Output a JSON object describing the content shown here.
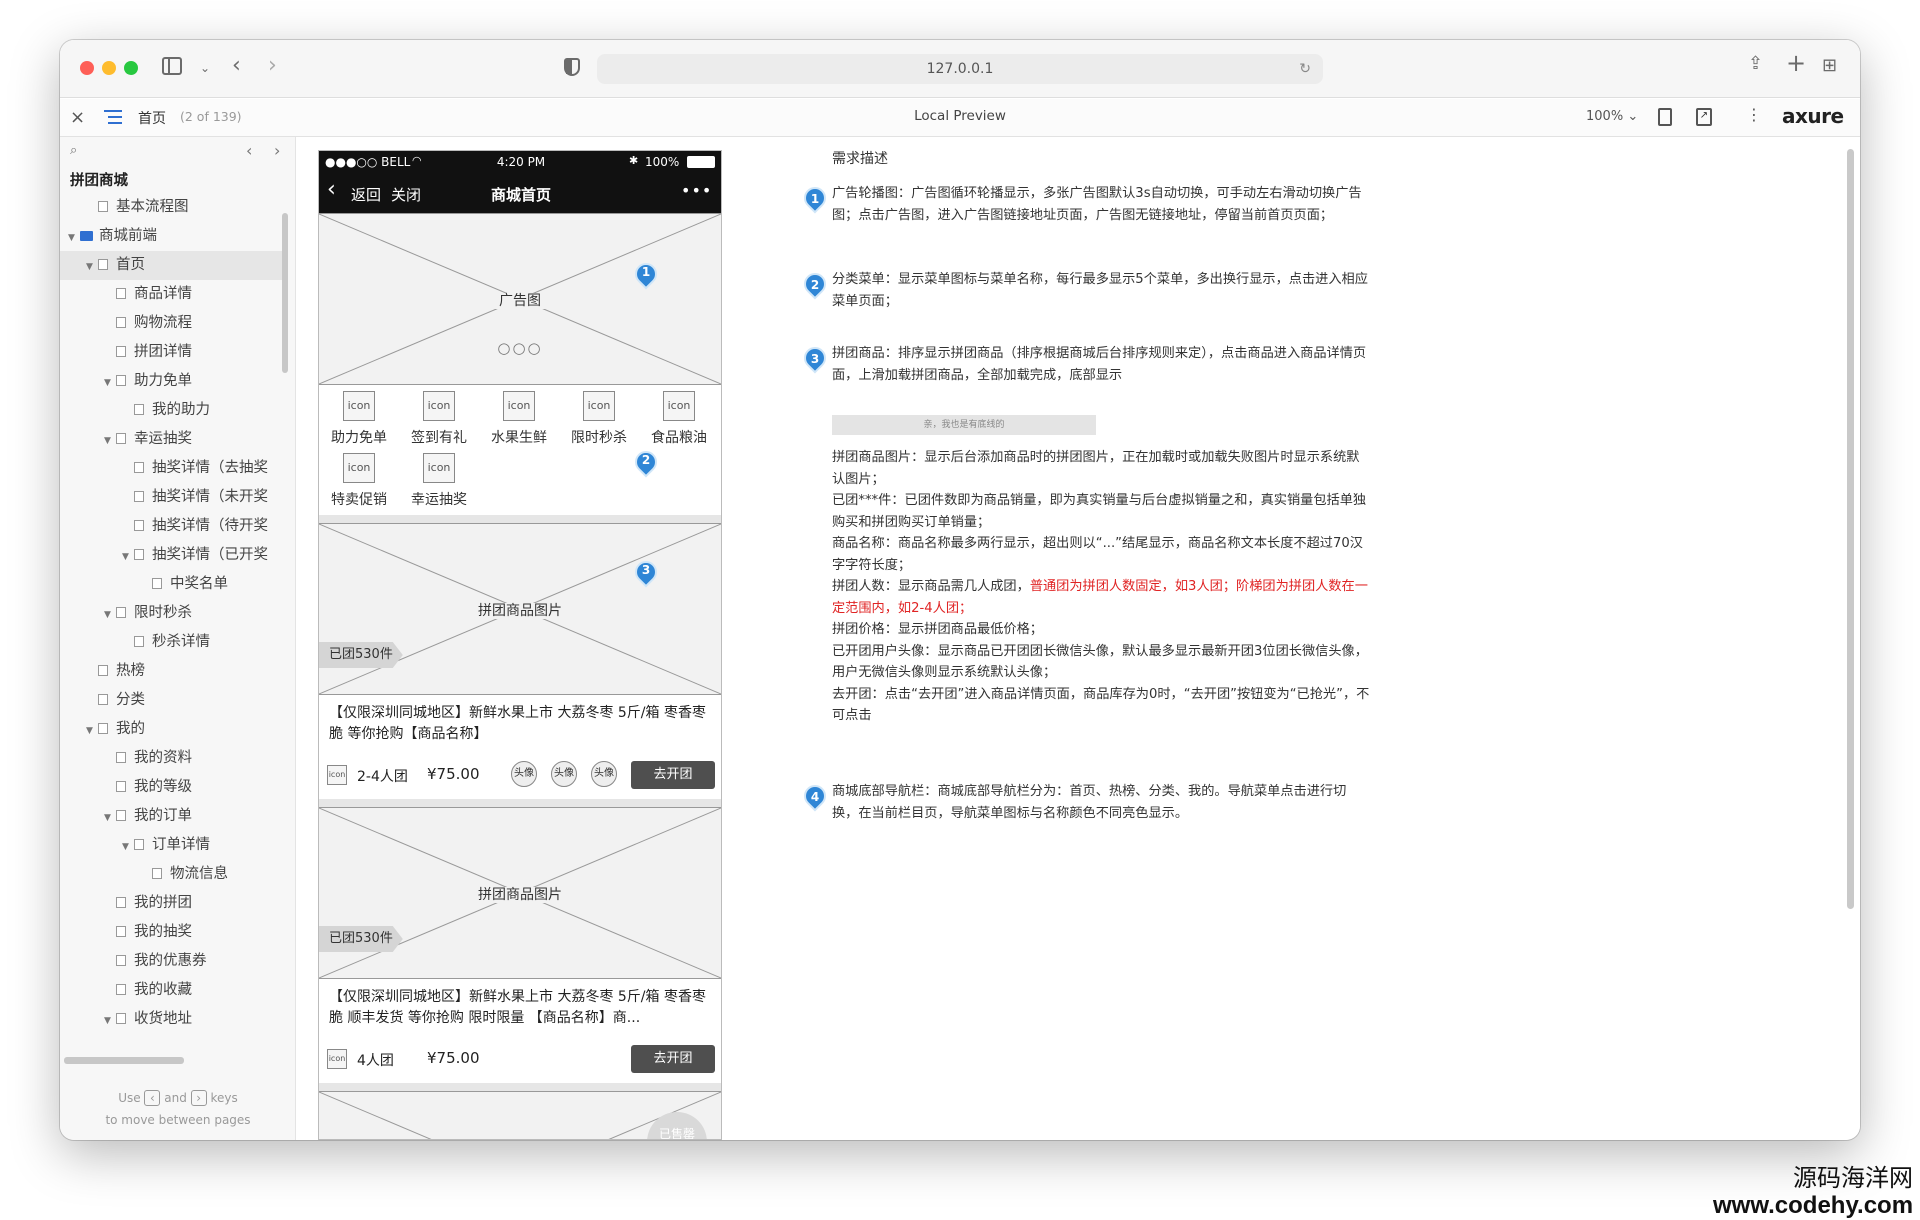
{
  "browser": {
    "url": "127.0.0.1",
    "traffic_colors": [
      "#fe5f57",
      "#febc2e",
      "#28c840"
    ]
  },
  "toolbar": {
    "close_label": "×",
    "page_name": "首页",
    "page_count": "(2 of 139)",
    "center_title": "Local Preview",
    "zoom": "100%",
    "brand": "axure"
  },
  "sidebar": {
    "nav_hint_1": "Use",
    "nav_hint_and": "and",
    "nav_hint_keys": "keys",
    "nav_hint_2": "to move between pages",
    "root": "拼团商城",
    "items": [
      {
        "label": "基本流程图",
        "level": 1,
        "type": "page",
        "arrow": ""
      },
      {
        "label": "商城前端",
        "level": 0,
        "type": "folder",
        "arrow": "▼"
      },
      {
        "label": "首页",
        "level": 1,
        "type": "page",
        "arrow": "▼",
        "selected": true
      },
      {
        "label": "商品详情",
        "level": 2,
        "type": "page",
        "arrow": ""
      },
      {
        "label": "购物流程",
        "level": 2,
        "type": "page",
        "arrow": ""
      },
      {
        "label": "拼团详情",
        "level": 2,
        "type": "page",
        "arrow": ""
      },
      {
        "label": "助力免单",
        "level": 2,
        "type": "page",
        "arrow": "▼"
      },
      {
        "label": "我的助力",
        "level": 3,
        "type": "page",
        "arrow": ""
      },
      {
        "label": "幸运抽奖",
        "level": 2,
        "type": "page",
        "arrow": "▼"
      },
      {
        "label": "抽奖详情（去抽奖",
        "level": 3,
        "type": "page",
        "arrow": ""
      },
      {
        "label": "抽奖详情（未开奖",
        "level": 3,
        "type": "page",
        "arrow": ""
      },
      {
        "label": "抽奖详情（待开奖",
        "level": 3,
        "type": "page",
        "arrow": ""
      },
      {
        "label": "抽奖详情（已开奖",
        "level": 3,
        "type": "page",
        "arrow": "▼"
      },
      {
        "label": "中奖名单",
        "level": 4,
        "type": "page",
        "arrow": ""
      },
      {
        "label": "限时秒杀",
        "level": 2,
        "type": "page",
        "arrow": "▼"
      },
      {
        "label": "秒杀详情",
        "level": 3,
        "type": "page",
        "arrow": ""
      },
      {
        "label": "热榜",
        "level": 1,
        "type": "page",
        "arrow": ""
      },
      {
        "label": "分类",
        "level": 1,
        "type": "page",
        "arrow": ""
      },
      {
        "label": "我的",
        "level": 1,
        "type": "page",
        "arrow": "▼"
      },
      {
        "label": "我的资料",
        "level": 2,
        "type": "page",
        "arrow": ""
      },
      {
        "label": "我的等级",
        "level": 2,
        "type": "page",
        "arrow": ""
      },
      {
        "label": "我的订单",
        "level": 2,
        "type": "page",
        "arrow": "▼"
      },
      {
        "label": "订单详情",
        "level": 3,
        "type": "page",
        "arrow": "▼"
      },
      {
        "label": "物流信息",
        "level": 4,
        "type": "page",
        "arrow": ""
      },
      {
        "label": "我的拼团",
        "level": 2,
        "type": "page",
        "arrow": ""
      },
      {
        "label": "我的抽奖",
        "level": 2,
        "type": "page",
        "arrow": ""
      },
      {
        "label": "我的优惠券",
        "level": 2,
        "type": "page",
        "arrow": ""
      },
      {
        "label": "我的收藏",
        "level": 2,
        "type": "page",
        "arrow": ""
      },
      {
        "label": "收货地址",
        "level": 2,
        "type": "page",
        "arrow": "▼"
      }
    ]
  },
  "phone": {
    "status_carrier": "●●●○○ BELL",
    "status_time": "4:20 PM",
    "status_battery": "100%",
    "nav_back": "返回",
    "nav_close": "关闭",
    "nav_title": "商城首页",
    "nav_more": "•••",
    "banner_label": "广告图",
    "banner_dots": "○○○",
    "categories": [
      {
        "icon": "icon",
        "label": "助力免单"
      },
      {
        "icon": "icon",
        "label": "签到有礼"
      },
      {
        "icon": "icon",
        "label": "水果生鲜"
      },
      {
        "icon": "icon",
        "label": "限时秒杀"
      },
      {
        "icon": "icon",
        "label": "食品粮油"
      },
      {
        "icon": "icon",
        "label": "特卖促销"
      },
      {
        "icon": "icon",
        "label": "幸运抽奖"
      }
    ],
    "products": [
      {
        "image_label": "拼团商品图片",
        "sold": "已团530件",
        "title": "【仅限深圳同城地区】新鲜水果上市 大荔冬枣 5斤/箱 枣香枣脆 等你抢购【商品名称】",
        "icon": "icon",
        "group": "2-4人团",
        "price": "¥75.00",
        "avatars": [
          "头像",
          "头像",
          "头像"
        ],
        "button": "去开团"
      },
      {
        "image_label": "拼团商品图片",
        "sold": "已团530件",
        "title": "【仅限深圳同城地区】新鲜水果上市 大荔冬枣 5斤/箱 枣香枣脆 顺丰发货 等你抢购 限时限量 【商品名称】商...",
        "icon": "icon",
        "group": "4人团",
        "price": "¥75.00",
        "avatars": [],
        "button": "去开团"
      }
    ],
    "soldout_badge": "已售罄"
  },
  "requirements": {
    "title": "需求描述",
    "items": [
      {
        "num": "1",
        "text": "广告轮播图：广告图循环轮播显示，多张广告图默认3s自动切换，可手动左右滑动切换广告图；点击广告图，进入广告图链接地址页面，广告图无链接地址，停留当前首页页面；"
      },
      {
        "num": "2",
        "text": "分类菜单：显示菜单图标与菜单名称，每行最多显示5个菜单，多出换行显示，点击进入相应菜单页面；"
      },
      {
        "num": "3",
        "text": "拼团商品：排序显示拼团商品（排序根据商城后台排序规则来定），点击商品进入商品详情页面，上滑加载拼团商品，全部加载完成，底部显示"
      }
    ],
    "footer_bar": "亲，我也是有底线的",
    "details": [
      "拼团商品图片：显示后台添加商品时的拼团图片，正在加载时或加载失败图片时显示系统默认图片；",
      "已团***件：已团件数即为商品销量，即为真实销量与后台虚拟销量之和，真实销量包括单独购买和拼团购买订单销量；",
      "商品名称：商品名称最多两行显示，超出则以“...”结尾显示，商品名称文本长度不超过70汉字字符长度；"
    ],
    "group_prefix": "拼团人数：显示商品需几人成团，",
    "group_red": "普通团为拼团人数固定，如3人团；阶梯团为拼团人数在一定范围内，如2-4人团；",
    "details2": [
      "拼团价格：显示拼团商品最低价格；",
      "已开团用户头像：显示商品已开团团长微信头像，默认最多显示最新开团3位团长微信头像，用户无微信头像则显示系统默认头像；",
      "去开团：点击“去开团”进入商品详情页面，商品库存为0时，“去开团”按钮变为“已抢光”，不可点击"
    ],
    "item4": {
      "num": "4",
      "text": "商城底部导航栏：商城底部导航栏分为：首页、热榜、分类、我的。导航菜单点击进行切换，在当前栏目页，导航菜单图标与名称颜色不同亮色显示。"
    }
  },
  "watermark": {
    "line1": "源码海洋网",
    "line2": "www.codehy.com"
  }
}
